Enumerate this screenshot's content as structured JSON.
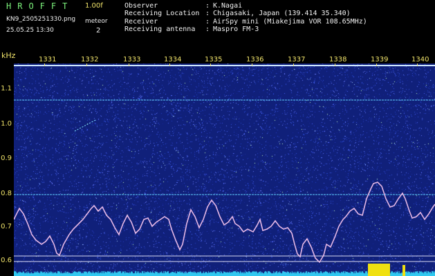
{
  "app": {
    "title": "HROFFT",
    "version": "1.00f"
  },
  "file": {
    "name": "KN9_2505251330.png",
    "datetime": "25.05.25 13:30"
  },
  "meteor": {
    "label": "meteor",
    "count": "2"
  },
  "info": [
    {
      "label": "Observer",
      "value": "K.Nagai"
    },
    {
      "label": "Receiving Location",
      "value": "Chigasaki, Japan (139.414 35.340)"
    },
    {
      "label": "Receiver",
      "value": "AirSpy mini (Miakejima VOR 108.65MHz)"
    },
    {
      "label": "Receiving antenna",
      "value": "Maspro FM-3"
    }
  ],
  "axis": {
    "unit": "kHz",
    "y_ticks": [
      "1.1",
      "1.0",
      "0.9",
      "0.8",
      "0.7",
      "0.6"
    ],
    "x_ticks": [
      "1331",
      "1332",
      "1333",
      "1334",
      "1335",
      "1336",
      "1337",
      "1338",
      "1339",
      "1340"
    ]
  },
  "colors": {
    "background": "#10207a",
    "header_text": "#7cf27c",
    "axis_text": "#f0e36a",
    "trace": "#e6b8e6",
    "reference_lines": "#5fd0ff"
  }
}
